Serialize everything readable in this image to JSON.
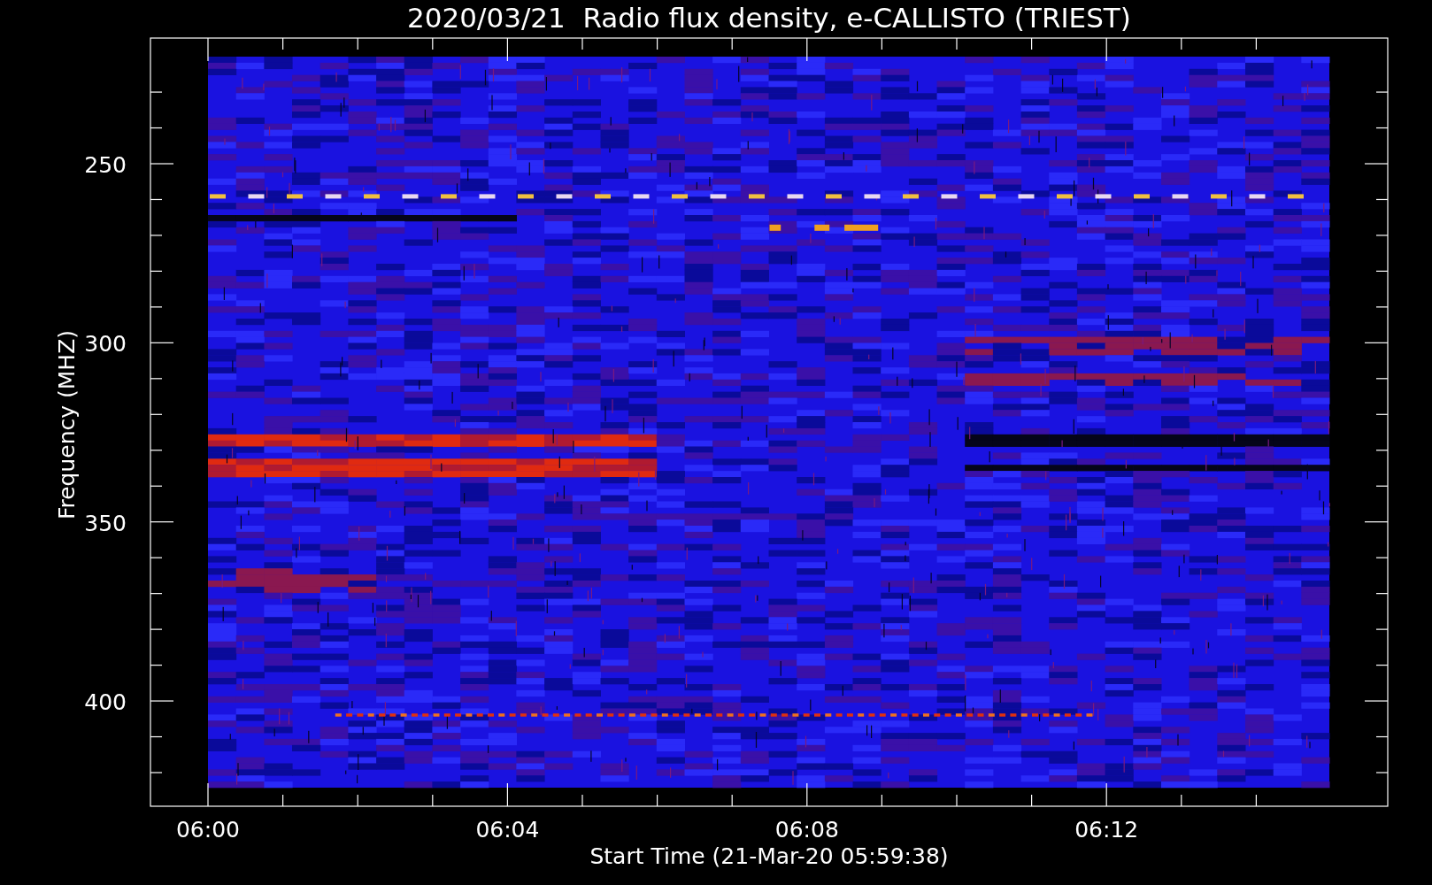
{
  "title": "2020/03/21  Radio flux density, e-CALLISTO (TRIEST)",
  "plot": {
    "ylabel": "Frequency (MHZ)",
    "xlabel": "Start Time (21-Mar-20 05:59:38)",
    "yticks": [
      "250",
      "300",
      "350",
      "400"
    ],
    "xticks": [
      "06:00",
      "06:04",
      "06:08",
      "06:12"
    ]
  }
}
